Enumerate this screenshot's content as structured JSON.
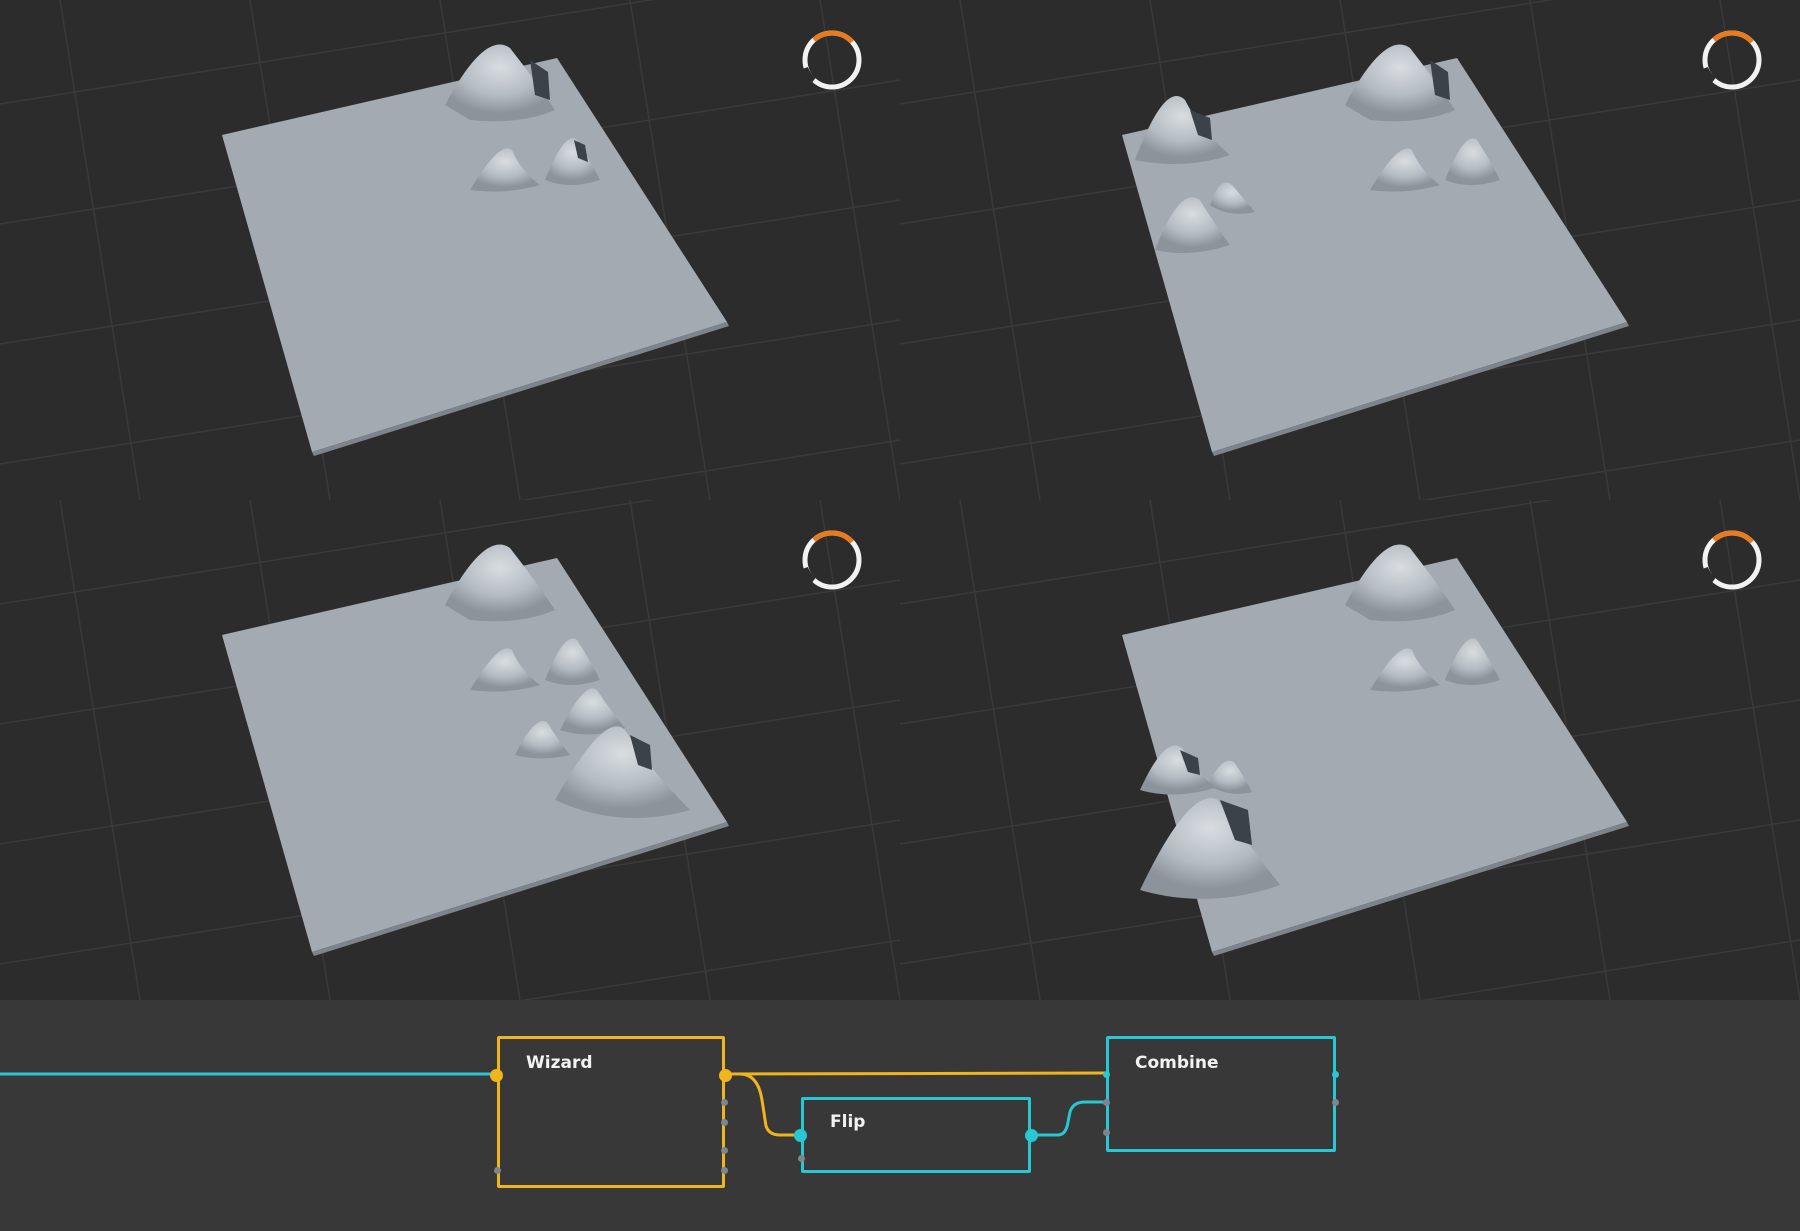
{
  "viewports": [
    {
      "id": "viewport-top-left"
    },
    {
      "id": "viewport-top-right"
    },
    {
      "id": "viewport-bottom-left"
    },
    {
      "id": "viewport-bottom-right"
    }
  ],
  "spinner": {
    "icon": "loading-spinner-icon",
    "accent_color": "#e87b1e",
    "ring_color": "#f2f2f2"
  },
  "colors": {
    "background": "#2b2b2b",
    "grid": "#3a3a3a",
    "terrain": "#a3aab2",
    "graph_background": "#383838",
    "node_wizard": "#f0b51c",
    "node_teal": "#27c7d3"
  },
  "nodes": {
    "wizard": {
      "title": "Wizard"
    },
    "flip": {
      "title": "Flip"
    },
    "combine": {
      "title": "Combine"
    }
  }
}
